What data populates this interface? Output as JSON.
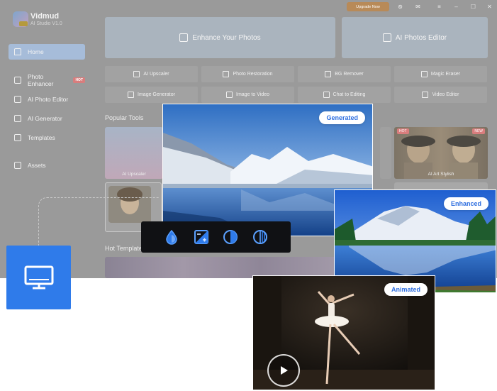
{
  "app": {
    "brand_name": "Vidmud",
    "brand_sub": "AI Studio V1.0",
    "upgrade_label": "Upgrade Now",
    "sidebar": {
      "items": [
        {
          "label": "Home",
          "icon": "home-icon",
          "active": true
        },
        {
          "label": "Photo Enhancer",
          "icon": "magic-wand-icon",
          "badge": "HOT"
        },
        {
          "label": "AI Photo Editor",
          "icon": "edit-icon"
        },
        {
          "label": "AI Generator",
          "icon": "sparkle-image-icon"
        },
        {
          "label": "Templates",
          "icon": "templates-icon"
        },
        {
          "label": "Assets",
          "icon": "folder-icon"
        }
      ]
    },
    "hero_buttons": [
      {
        "label": "Enhance Your Photos",
        "icon": "magic-wand-icon"
      },
      {
        "label": "AI Photos Editor",
        "icon": "edit-icon"
      }
    ],
    "tools": [
      {
        "label": "AI Upscaler",
        "icon": "upscale-icon"
      },
      {
        "label": "Photo Restoration",
        "icon": "restore-icon"
      },
      {
        "label": "BG Remover",
        "icon": "bg-remove-icon"
      },
      {
        "label": "Magic Eraser",
        "icon": "eraser-icon"
      },
      {
        "label": "Image Generator",
        "icon": "image-gen-icon"
      },
      {
        "label": "Image to Video",
        "icon": "video-icon"
      },
      {
        "label": "Chat to Editing",
        "icon": "chat-icon"
      },
      {
        "label": "Video Editor",
        "icon": "film-icon"
      }
    ],
    "popular_tools_title": "Popular Tools",
    "popular_cards": [
      {
        "label": "AI Upscaler"
      },
      {
        "label": "AI Art Stylish",
        "tags": [
          "HOT",
          "NEW"
        ]
      }
    ],
    "hot_templates_title": "Hot Templates"
  },
  "showcase": {
    "generated_label": "Generated",
    "enhanced_label": "Enhanced",
    "animated_label": "Animated",
    "toolbar_icons": [
      "water-drop-icon",
      "exposure-icon",
      "contrast-icon",
      "grain-icon"
    ]
  },
  "colors": {
    "accent": "#2f7bea",
    "pill_text": "#2f6fe0"
  }
}
